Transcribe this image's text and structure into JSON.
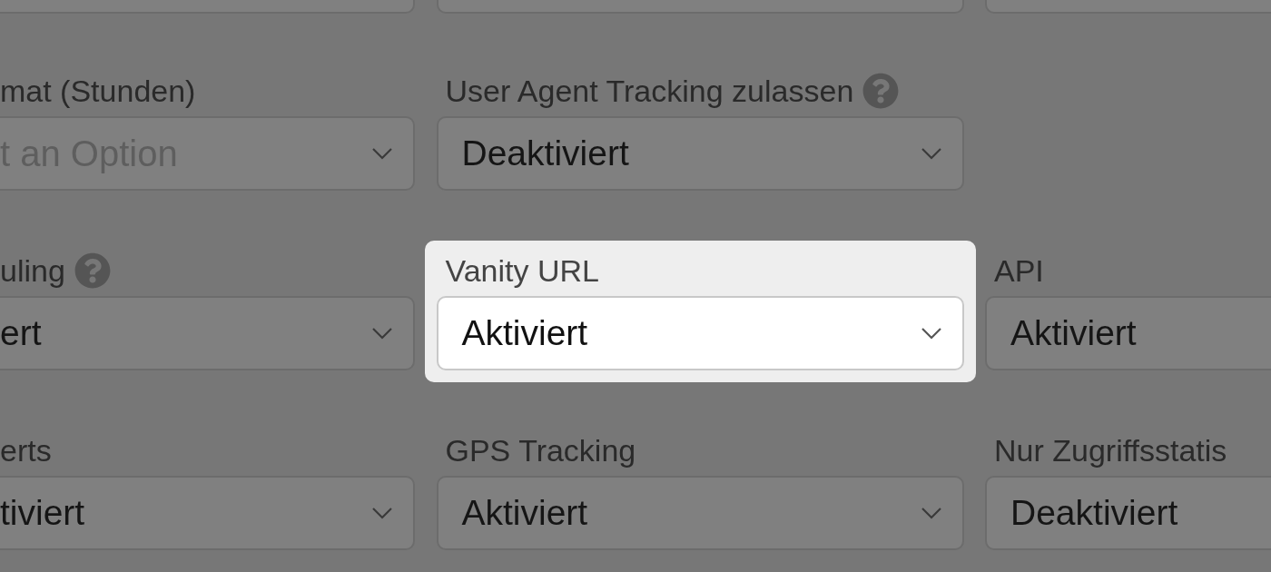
{
  "rows": [
    {
      "fields": [
        {
          "label": "mat (Stunden)",
          "placeholder": "t an Option",
          "help": false,
          "highlighted": false
        },
        {
          "label": "User Agent Tracking zulassen",
          "value": "Deaktiviert",
          "help": true,
          "highlighted": false
        }
      ]
    },
    {
      "fields": [
        {
          "label": "uling",
          "value": "ert",
          "help": true,
          "highlighted": false
        },
        {
          "label": "Vanity URL",
          "value": "Aktiviert",
          "help": false,
          "highlighted": true
        },
        {
          "label": "API",
          "value": "Aktiviert",
          "help": false,
          "highlighted": false
        }
      ]
    },
    {
      "fields": [
        {
          "label": "erts",
          "value": "tiviert",
          "help": false,
          "highlighted": false
        },
        {
          "label": "GPS Tracking",
          "value": "Aktiviert",
          "help": false,
          "highlighted": false
        },
        {
          "label": "Nur Zugriffsstatis",
          "value": "Deaktiviert",
          "help": false,
          "highlighted": false
        }
      ]
    }
  ]
}
